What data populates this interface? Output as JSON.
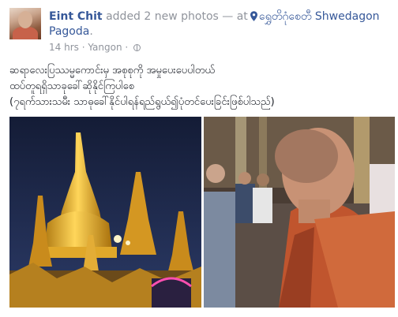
{
  "post": {
    "author": "Eint Chit",
    "action": "added 2 new photos",
    "separator": "— at",
    "location": "ရွှေတိဂုံစေတီ Shwedagon Pagoda",
    "location_end": ".",
    "time": "14 hrs",
    "dot": "·",
    "city": "Yangon",
    "dot2": "·",
    "privacy_icon": "globe-icon",
    "location_icon": "map-pin-icon",
    "caption": [
      "ဆရာလေးပြဿမ္မကောင်းမှ အစုစုကို အမှုပေးပေပါတယ်",
      "ထပ်တူရရှိသာခုခေါ်ဆိုနိုင်ကြပါစေ",
      "(၇ရက်သားသမီး သာဓုခေါ်နိုင်ပါရန်ရည်ရွယ်၍ပုံတင်ပေးခြင်းဖြစ်ပါသည်)"
    ]
  },
  "colors": {
    "link": "#365899",
    "muted": "#90949c",
    "text": "#1d2129"
  }
}
